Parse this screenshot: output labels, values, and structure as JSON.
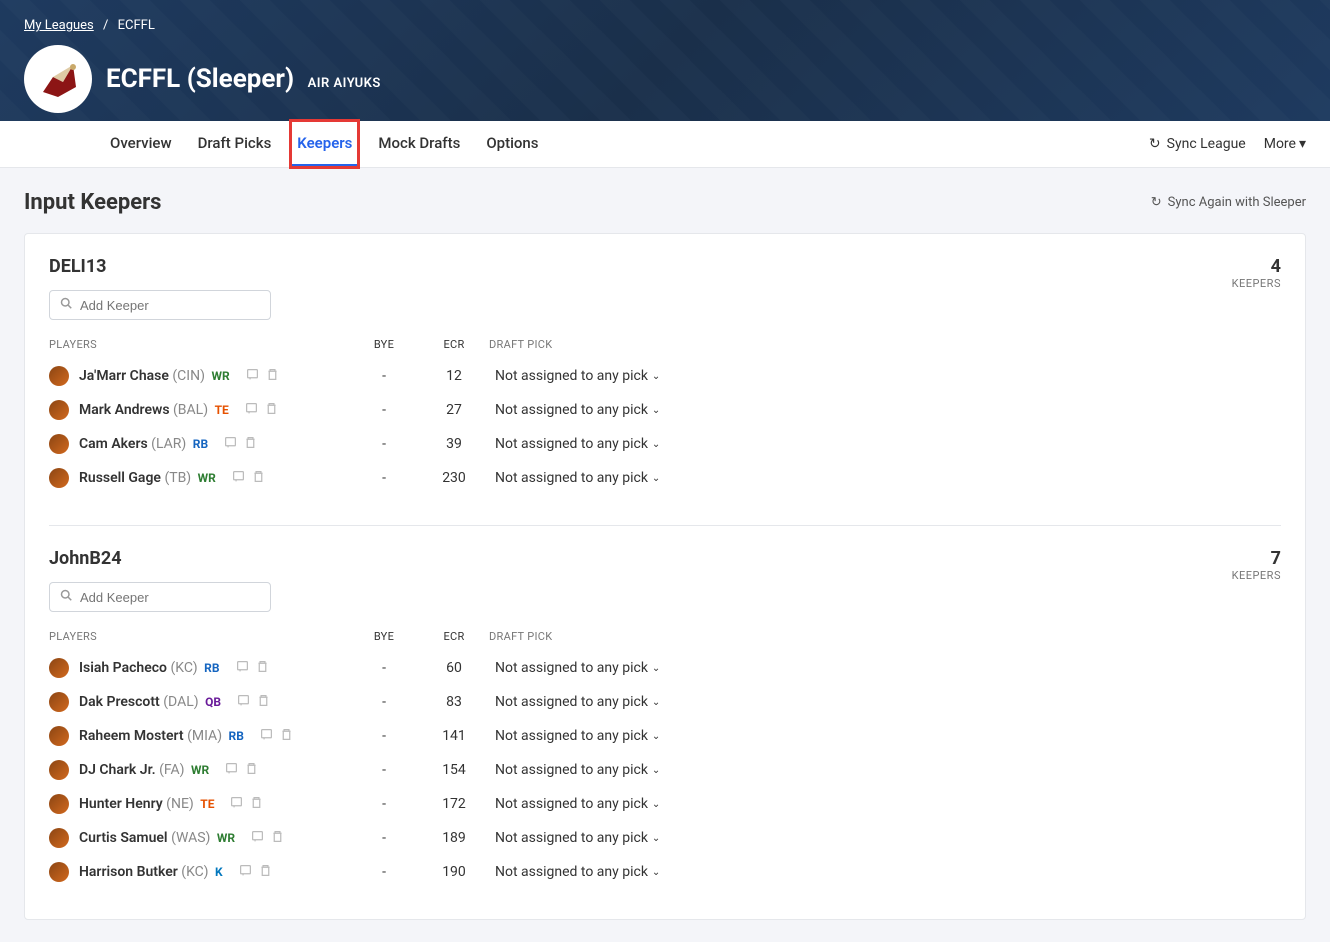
{
  "breadcrumb": {
    "home": "My Leagues",
    "current": "ECFFL"
  },
  "league": {
    "title": "ECFFL (Sleeper)",
    "sub": "AIR AIYUKS"
  },
  "tabs": {
    "overview": "Overview",
    "draftpicks": "Draft Picks",
    "keepers": "Keepers",
    "mockdrafts": "Mock Drafts",
    "options": "Options"
  },
  "headerRight": {
    "sync": "Sync League",
    "more": "More"
  },
  "page": {
    "title": "Input Keepers",
    "syncAgain": "Sync Again with Sleeper"
  },
  "search": {
    "placeholder": "Add Keeper"
  },
  "tableHeaders": {
    "players": "PLAYERS",
    "bye": "BYE",
    "ecr": "ECR",
    "draftpick": "DRAFT PICK"
  },
  "keepersLabel": "KEEPERS",
  "draftPickDefault": "Not assigned to any pick",
  "teams": [
    {
      "name": "DELI13",
      "count": "4",
      "players": [
        {
          "name": "Ja'Marr Chase",
          "team": "(CIN)",
          "pos": "WR",
          "bye": "-",
          "ecr": "12"
        },
        {
          "name": "Mark Andrews",
          "team": "(BAL)",
          "pos": "TE",
          "bye": "-",
          "ecr": "27"
        },
        {
          "name": "Cam Akers",
          "team": "(LAR)",
          "pos": "RB",
          "bye": "-",
          "ecr": "39"
        },
        {
          "name": "Russell Gage",
          "team": "(TB)",
          "pos": "WR",
          "bye": "-",
          "ecr": "230"
        }
      ]
    },
    {
      "name": "JohnB24",
      "count": "7",
      "players": [
        {
          "name": "Isiah Pacheco",
          "team": "(KC)",
          "pos": "RB",
          "bye": "-",
          "ecr": "60"
        },
        {
          "name": "Dak Prescott",
          "team": "(DAL)",
          "pos": "QB",
          "bye": "-",
          "ecr": "83"
        },
        {
          "name": "Raheem Mostert",
          "team": "(MIA)",
          "pos": "RB",
          "bye": "-",
          "ecr": "141"
        },
        {
          "name": "DJ Chark Jr.",
          "team": "(FA)",
          "pos": "WR",
          "bye": "-",
          "ecr": "154"
        },
        {
          "name": "Hunter Henry",
          "team": "(NE)",
          "pos": "TE",
          "bye": "-",
          "ecr": "172"
        },
        {
          "name": "Curtis Samuel",
          "team": "(WAS)",
          "pos": "WR",
          "bye": "-",
          "ecr": "189"
        },
        {
          "name": "Harrison Butker",
          "team": "(KC)",
          "pos": "K",
          "bye": "-",
          "ecr": "190"
        }
      ]
    }
  ]
}
